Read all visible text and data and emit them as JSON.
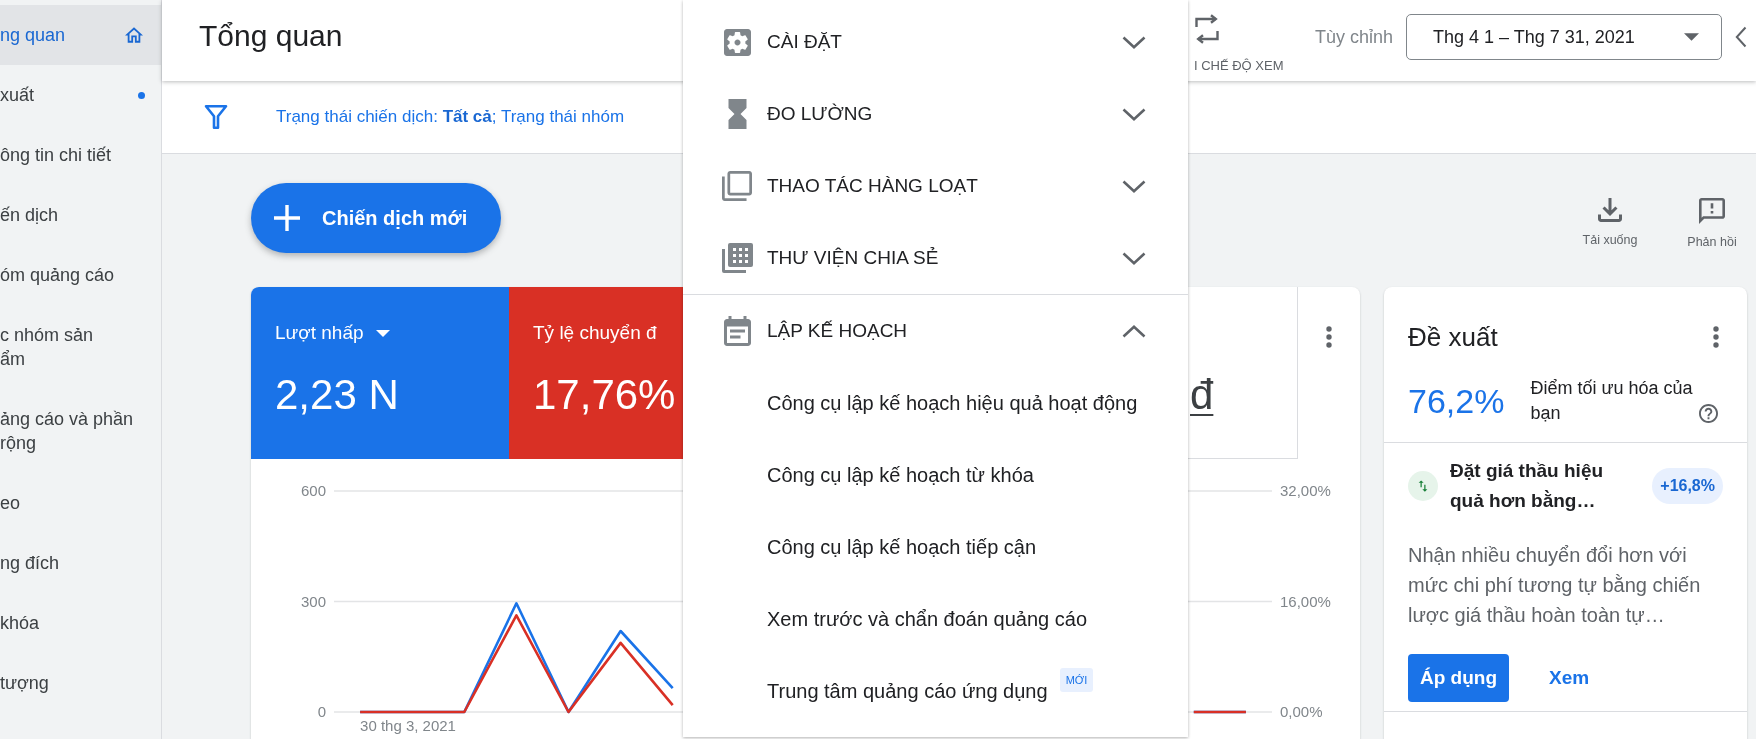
{
  "sidebar": {
    "items": [
      {
        "kind": "home",
        "lines": [
          "ng quan"
        ],
        "selected": true,
        "dot": false
      },
      {
        "kind": "page",
        "lines": [
          "xuất"
        ],
        "selected": false,
        "dot": true
      },
      {
        "kind": "page",
        "lines": [
          "ông tin chi tiết"
        ],
        "selected": false,
        "dot": false
      },
      {
        "kind": "page",
        "lines": [
          "ến dịch"
        ],
        "selected": false,
        "dot": false
      },
      {
        "kind": "page",
        "lines": [
          "óm quảng cáo"
        ],
        "selected": false,
        "dot": false
      },
      {
        "kind": "page",
        "lines": [
          "c nhóm sản",
          "ẩm"
        ],
        "selected": false,
        "dot": false
      },
      {
        "kind": "page",
        "lines": [
          "ảng cáo và phần",
          "rộng"
        ],
        "selected": false,
        "dot": false
      },
      {
        "kind": "page",
        "lines": [
          "eo"
        ],
        "selected": false,
        "dot": false
      },
      {
        "kind": "page",
        "lines": [
          "ng đích"
        ],
        "selected": false,
        "dot": false
      },
      {
        "kind": "page",
        "lines": [
          "khóa"
        ],
        "selected": false,
        "dot": false
      },
      {
        "kind": "page",
        "lines": [
          "tượng"
        ],
        "selected": false,
        "dot": false
      }
    ]
  },
  "header": {
    "title": "Tổng quan",
    "view_switch": "I CHẾ ĐỘ XEM",
    "range_label": "Tùy chỉnh",
    "date_range": "Thg 4 1 – Thg 7 31, 2021"
  },
  "filter_bar": {
    "text": "Trạng thái chiến dịch: **Tất cả**; Trạng thái nhóm"
  },
  "toolbar": {
    "new_campaign": "Chiến dịch mới",
    "actions": [
      {
        "kind": "download",
        "label": "Tải xuống"
      },
      {
        "kind": "feedback",
        "label": "Phản hồi"
      }
    ]
  },
  "overview_card": {
    "metrics": [
      {
        "label": "Lượt nhấp",
        "value": "2,23 N",
        "selected": true,
        "color": "#1a73e8",
        "dropdown": true
      },
      {
        "label": "Tỷ lệ chuyển đ",
        "value": "17,76%",
        "selected": true,
        "color": "#d93025",
        "dropdown": false
      },
      {
        "value": "đ",
        "selected": false
      }
    ],
    "chart_start_date": "30 thg 3, 2021",
    "chart_data": {
      "type": "line",
      "ylim": [
        0,
        600
      ],
      "yticks": [
        0,
        300,
        600
      ],
      "y2lim": [
        0,
        32
      ],
      "y2ticks": [
        {
          "value": 0,
          "label": "0,00%"
        },
        {
          "value": 16,
          "label": "16,00%"
        },
        {
          "value": 32,
          "label": "32,00%"
        }
      ],
      "series": [
        {
          "color": "#1a73e8",
          "values": [
            0,
            0,
            0,
            295,
            0,
            220,
            65,
            null,
            null,
            null,
            null,
            null,
            null,
            null,
            null,
            null,
            0,
            0
          ]
        },
        {
          "color": "#d93025",
          "axis": "y2",
          "values": [
            0,
            0,
            0,
            14,
            0,
            10,
            1,
            null,
            null,
            null,
            null,
            null,
            null,
            null,
            null,
            null,
            0,
            0
          ]
        }
      ]
    }
  },
  "recommendations": {
    "title": "Đề xuất",
    "score": "76,2%",
    "score_label": "Điểm tối ưu hóa của bạn",
    "item": {
      "title": "Đặt giá thầu hiệu quả hơn bằng…",
      "uplift": "+16,8%",
      "description": "Nhận nhiều chuyển đổi hơn với mức chi phí tương tự bằng chiến lược giá thầu hoàn toàn tự…",
      "apply": "Áp dụng",
      "view": "Xem"
    }
  },
  "menu": {
    "sections": [
      {
        "kind": "settings",
        "label": "CÀI ĐẶT",
        "expanded": false
      },
      {
        "kind": "measurement",
        "label": "ĐO LƯỜNG",
        "expanded": false
      },
      {
        "kind": "bulk",
        "label": "THAO TÁC HÀNG LOẠT",
        "expanded": false
      },
      {
        "kind": "library",
        "label": "THƯ VIỆN CHIA SẺ",
        "expanded": false
      },
      {
        "kind": "planning",
        "label": "LẬP KẾ HOẠCH",
        "expanded": true,
        "children": [
          {
            "label": "Công cụ lập kế hoạch hiệu quả hoạt động"
          },
          {
            "label": "Công cụ lập kế hoạch từ khóa"
          },
          {
            "label": "Công cụ lập kế hoạch tiếp cận"
          },
          {
            "label": "Xem trước và chẩn đoán quảng cáo"
          },
          {
            "label": "Trung tâm quảng cáo ứng dụng",
            "badge": "MỚI"
          }
        ]
      }
    ]
  }
}
